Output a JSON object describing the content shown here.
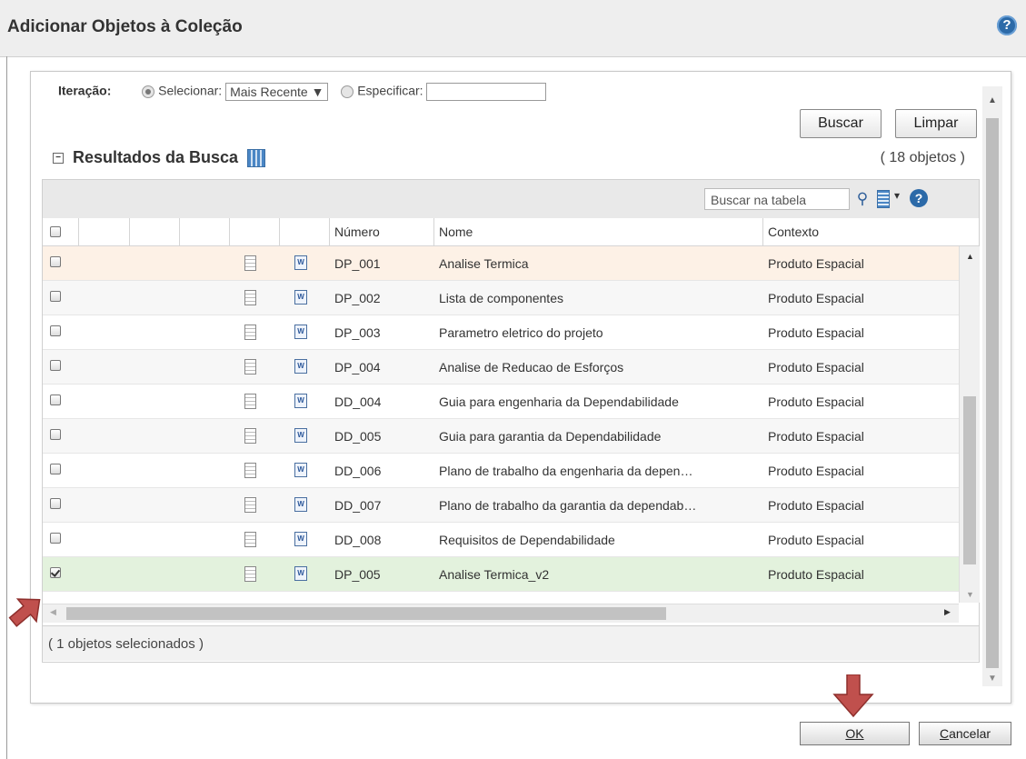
{
  "dialog": {
    "title": "Adicionar Objetos à Coleção",
    "help_glyph": "?"
  },
  "search_form": {
    "iteration_label": "Iteração:",
    "select_label": "Selecionar:",
    "select_value": "Mais Recente",
    "select_caret": "▼",
    "specify_label": "Especificar:",
    "search_button": "Buscar",
    "clear_button": "Limpar"
  },
  "results": {
    "title": "Resultados da Busca",
    "count": "( 18 objetos )",
    "table_search_placeholder": "Buscar na tabela",
    "columns": {
      "number": "Número",
      "name": "Nome",
      "context": "Contexto"
    },
    "rows": [
      {
        "number": "DP_001",
        "name": "Analise Termica",
        "context": "Produto Espacial",
        "checked": false,
        "bg": "#fdf1e6"
      },
      {
        "number": "DP_002",
        "name": "Lista de componentes",
        "context": "Produto Espacial",
        "checked": false,
        "bg": "#f7f7f7"
      },
      {
        "number": "DP_003",
        "name": "Parametro eletrico do projeto",
        "context": "Produto Espacial",
        "checked": false,
        "bg": "#ffffff"
      },
      {
        "number": "DP_004",
        "name": "Analise de Reducao de Esforços",
        "context": "Produto Espacial",
        "checked": false,
        "bg": "#f7f7f7"
      },
      {
        "number": "DD_004",
        "name": "Guia para engenharia da Dependabilidade",
        "context": "Produto Espacial",
        "checked": false,
        "bg": "#ffffff"
      },
      {
        "number": "DD_005",
        "name": "Guia para garantia da Dependabilidade",
        "context": "Produto Espacial",
        "checked": false,
        "bg": "#f7f7f7"
      },
      {
        "number": "DD_006",
        "name": "Plano de trabalho da engenharia da depen…",
        "context": "Produto Espacial",
        "checked": false,
        "bg": "#ffffff"
      },
      {
        "number": "DD_007",
        "name": "Plano de trabalho da garantia da dependab…",
        "context": "Produto Espacial",
        "checked": false,
        "bg": "#f7f7f7"
      },
      {
        "number": "DD_008",
        "name": "Requisitos de Dependabilidade",
        "context": "Produto Espacial",
        "checked": false,
        "bg": "#ffffff"
      },
      {
        "number": "DP_005",
        "name": "Analise Termica_v2",
        "context": "Produto Espacial",
        "checked": true,
        "bg": "#e3f2dd"
      }
    ],
    "selected_count": "( 1 objetos selecionados )"
  },
  "actions": {
    "ok": "OK",
    "cancel_first": "C",
    "cancel_rest": "ancelar"
  },
  "colors": {
    "accent": "#2c6aa8",
    "arrow": "#c0504d",
    "selected_row": "#e3f2dd",
    "hover_row": "#fdf1e6"
  }
}
